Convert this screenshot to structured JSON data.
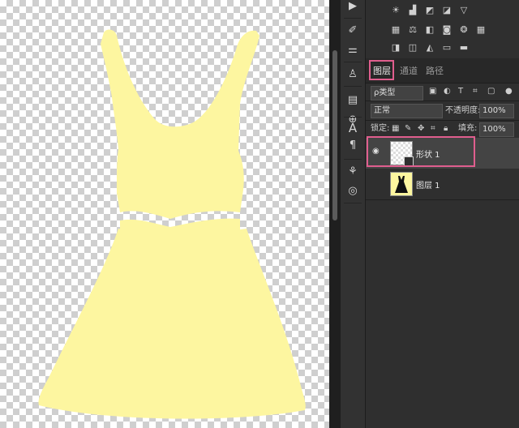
{
  "layers_panel": {
    "tabs": [
      {
        "label": "图层",
        "active": true
      },
      {
        "label": "通道",
        "active": false
      },
      {
        "label": "路径",
        "active": false
      }
    ],
    "filter_kind": "ρ类型",
    "blend_mode": "正常",
    "opacity_label": "不透明度:",
    "opacity_value": "100%",
    "lock_label": "锁定:",
    "fill_label": "填充:",
    "fill_value": "100%",
    "layers": [
      {
        "name": "形状 1",
        "visible": true,
        "selected": true
      },
      {
        "name": "图层 1",
        "visible": false,
        "selected": false
      }
    ]
  },
  "colors": {
    "dress_fill": "#fdf6a0",
    "highlight": "#e05e8e",
    "panel_bg": "#2f2f2f"
  }
}
